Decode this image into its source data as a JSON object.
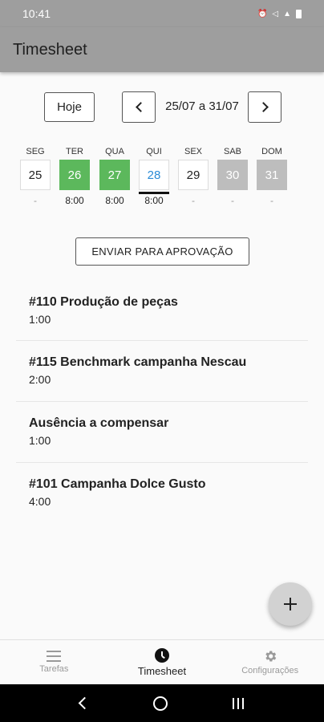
{
  "status_bar": {
    "time": "10:41"
  },
  "app_bar": {
    "title": "Timesheet"
  },
  "week_nav": {
    "today_label": "Hoje",
    "range": "25/07 a 31/07"
  },
  "days": [
    {
      "name": "SEG",
      "number": "25",
      "hours": "-",
      "state": "empty"
    },
    {
      "name": "TER",
      "number": "26",
      "hours": "8:00",
      "state": "done"
    },
    {
      "name": "QUA",
      "number": "27",
      "hours": "8:00",
      "state": "done"
    },
    {
      "name": "QUI",
      "number": "28",
      "hours": "8:00",
      "state": "current"
    },
    {
      "name": "SEX",
      "number": "29",
      "hours": "-",
      "state": "empty"
    },
    {
      "name": "SAB",
      "number": "30",
      "hours": "-",
      "state": "weekend"
    },
    {
      "name": "DOM",
      "number": "31",
      "hours": "-",
      "state": "weekend"
    }
  ],
  "send_button_label": "ENVIAR PARA APROVAÇÃO",
  "entries": [
    {
      "title": "#110 Produção de peças",
      "time": "1:00"
    },
    {
      "title": "#115 Benchmark campanha Nescau",
      "time": "2:00"
    },
    {
      "title": "Ausência a compensar",
      "time": "1:00"
    },
    {
      "title": "#101 Campanha Dolce Gusto",
      "time": "4:00"
    }
  ],
  "bottom_nav": {
    "items": [
      {
        "label": "Tarefas",
        "icon": "list-icon"
      },
      {
        "label": "Timesheet",
        "icon": "clock-icon"
      },
      {
        "label": "Configurações",
        "icon": "gear-icon"
      }
    ],
    "active_index": 1
  },
  "colors": {
    "app_bar": "#9e9e9e",
    "done": "#5cb85c",
    "weekend": "#bdbdbd",
    "current_text": "#2a8bd6"
  }
}
